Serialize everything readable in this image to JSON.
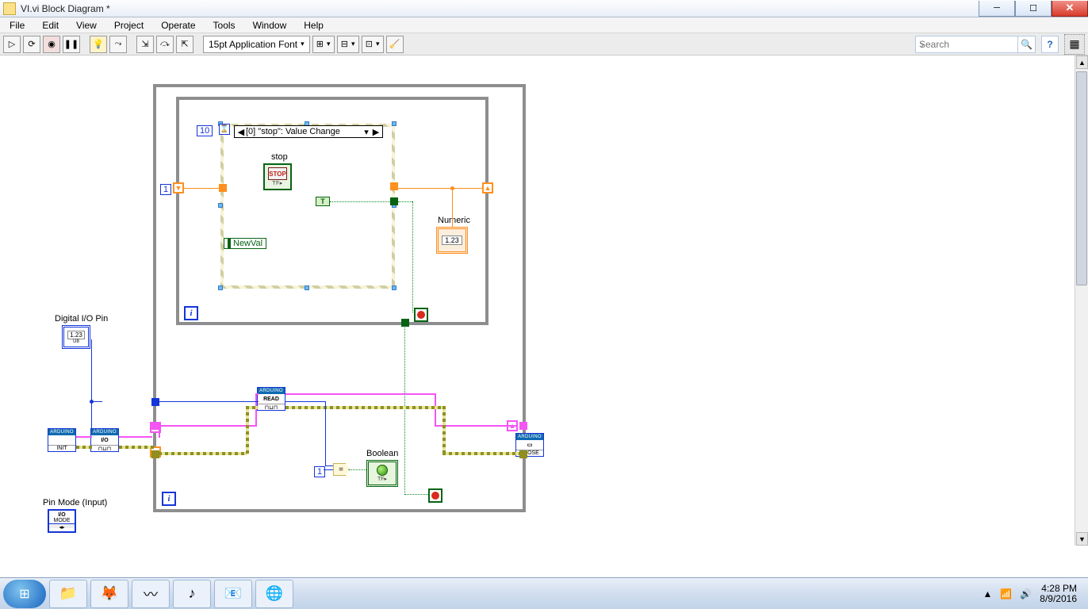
{
  "window": {
    "title": "VI.vi Block Diagram *"
  },
  "menu": [
    "File",
    "Edit",
    "View",
    "Project",
    "Operate",
    "Tools",
    "Window",
    "Help"
  ],
  "toolbar": {
    "font": "15pt Application Font",
    "search_placeholder": "Search"
  },
  "diagram": {
    "outer_loop": {
      "i": "i"
    },
    "inner_loop": {
      "i": "i",
      "timeout_const": "10",
      "one_const": "1"
    },
    "event": {
      "case_label": "[0] \"stop\": Value Change",
      "stop_label": "stop",
      "stop_face": "STOP",
      "newval": "NewVal"
    },
    "numeric": {
      "label": "Numeric",
      "display": "1.23"
    },
    "boolean": {
      "label": "Boolean"
    },
    "digital_pin": {
      "label": "Digital I/O Pin",
      "display": "1.23"
    },
    "pin_mode": {
      "label": "Pin Mode (Input)",
      "row1": "I/O",
      "row2": "MODE"
    },
    "bottom_const": "1",
    "equals": "=",
    "arduino": {
      "banner": "ARDUINO",
      "init": "INIT",
      "io": "I/O",
      "read": "READ",
      "close": "CLOSE"
    }
  },
  "system": {
    "time": "4:28 PM",
    "date": "8/9/2016"
  },
  "taskbar_apps": [
    "📁",
    "🦊",
    "〰",
    "♪",
    "📧",
    "🌐"
  ]
}
